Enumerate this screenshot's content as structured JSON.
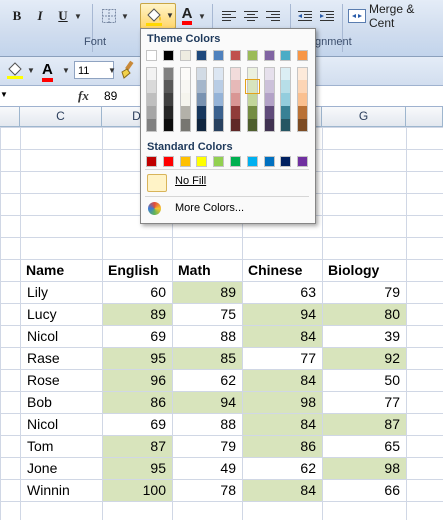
{
  "ribbon": {
    "bold_label": "B",
    "italic_label": "I",
    "underline_label": "U",
    "font_color_label": "A",
    "merge_label": "Merge & Cent",
    "font_group_label": "Font",
    "alignment_group_label": "gnment",
    "font_size": "11"
  },
  "formula_bar": {
    "fx_label": "fx",
    "value": "89"
  },
  "columns": [
    {
      "label": "C"
    },
    {
      "label": "D"
    },
    {
      "label": "G"
    }
  ],
  "fill_popup": {
    "theme_title": "Theme Colors",
    "standard_title": "Standard Colors",
    "no_fill_label": "No Fill",
    "more_colors_label": "More Colors...",
    "theme_colors": [
      "#ffffff",
      "#000000",
      "#eeece1",
      "#1f497d",
      "#4f81bd",
      "#c0504d",
      "#9bbb59",
      "#8064a2",
      "#4bacc6",
      "#f79646"
    ],
    "standard_colors": [
      "#c00000",
      "#ff0000",
      "#ffc000",
      "#ffff00",
      "#92d050",
      "#00b050",
      "#00b0f0",
      "#0070c0",
      "#002060",
      "#7030a0"
    ]
  },
  "table": {
    "headers": [
      "Name",
      "English",
      "Math",
      "Chinese",
      "Biology"
    ],
    "rows": [
      {
        "name": "Lily",
        "english": "60",
        "math": "89",
        "chinese": "63",
        "biology": "79"
      },
      {
        "name": "Lucy",
        "english": "89",
        "math": "75",
        "chinese": "94",
        "biology": "80"
      },
      {
        "name": "Nicol",
        "english": "69",
        "math": "88",
        "chinese": "84",
        "biology": "39"
      },
      {
        "name": "Rase",
        "english": "95",
        "math": "85",
        "chinese": "77",
        "biology": "92"
      },
      {
        "name": "Rose",
        "english": "96",
        "math": "62",
        "chinese": "84",
        "biology": "50"
      },
      {
        "name": "Bob",
        "english": "86",
        "math": "94",
        "chinese": "98",
        "biology": "77"
      },
      {
        "name": "Nicol",
        "english": "69",
        "math": "88",
        "chinese": "84",
        "biology": "87"
      },
      {
        "name": "Tom",
        "english": "87",
        "math": "79",
        "chinese": "86",
        "biology": "65"
      },
      {
        "name": "Jone",
        "english": "95",
        "math": "49",
        "chinese": "62",
        "biology": "98"
      },
      {
        "name": "Winnin",
        "english": "100",
        "math": "78",
        "chinese": "84",
        "biology": "66"
      }
    ],
    "highlight_color": "#d8e4bc"
  }
}
